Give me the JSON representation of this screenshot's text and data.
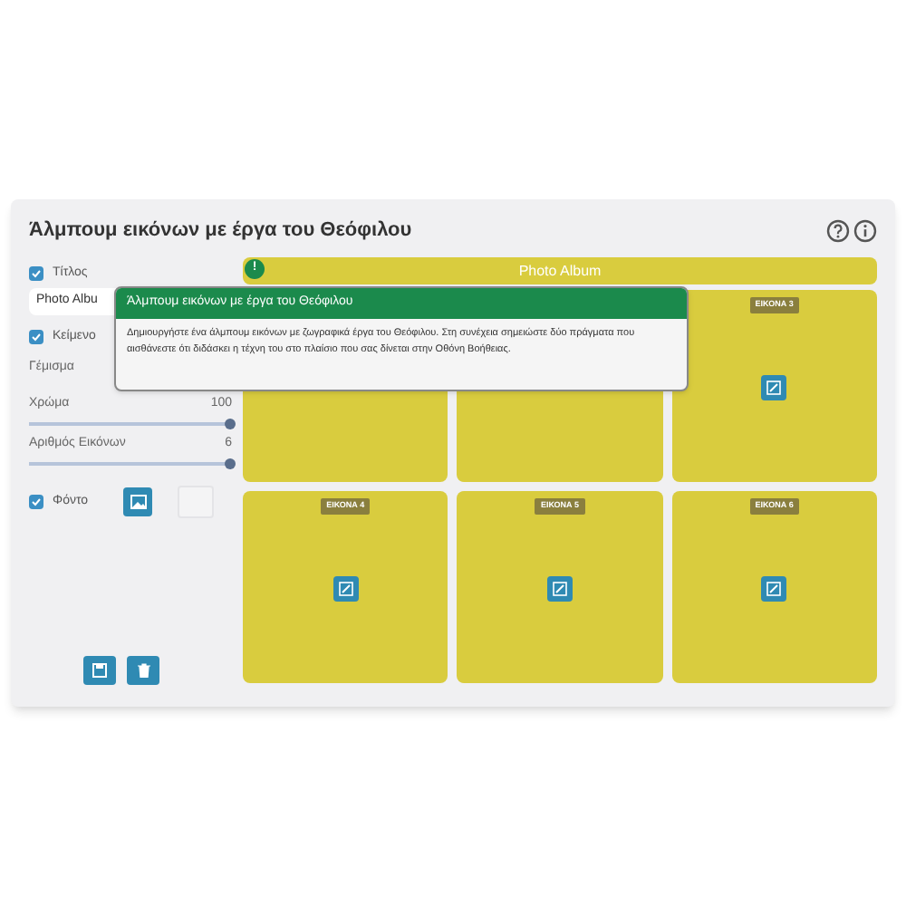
{
  "title": "Άλμπουμ εικόνων με έργα του Θεόφιλου",
  "help_buttons": [
    {
      "kind": "question"
    },
    {
      "kind": "info"
    }
  ],
  "controls": [
    {
      "kind": "checkbox",
      "label": "Τίτλος",
      "checked": true
    },
    {
      "kind": "input",
      "value": "Photo Albu"
    },
    {
      "kind": "checkbox",
      "label": "Κείμενο",
      "checked": true
    },
    {
      "kind": "text",
      "label": "Γέμισμα"
    },
    {
      "kind": "slider",
      "label": "Χρώμα",
      "reading": "100",
      "level": 1
    },
    {
      "kind": "slider",
      "label": "Αριθμός Εικόνων",
      "reading": "6",
      "level": 1
    },
    {
      "kind": "background",
      "label": "Φόντο",
      "checked": true
    }
  ],
  "album_title": "Photo Album",
  "cells": [
    {},
    {},
    {
      "label": "ΕΙΚΟΝΑ 3"
    },
    {
      "label": "ΕΙΚΟΝΑ 4"
    },
    {
      "label": "ΕΙΚΟΝΑ 5"
    },
    {
      "label": "ΕΙΚΟΝΑ 6"
    }
  ],
  "tooltip": {
    "marker": "!",
    "title": "Άλμπουμ εικόνων με έργα του Θεόφιλου",
    "text": "Δημιουργήστε ένα άλμπουμ εικόνων με ζωγραφικά έργα του Θεόφιλου. Στη συνέχεια σημειώστε δύο πράγματα που αισθάνεστε ότι διδάσκει η τέχνη του στο πλαίσιο που σας δίνεται στην Οθόνη Βοήθειας."
  }
}
